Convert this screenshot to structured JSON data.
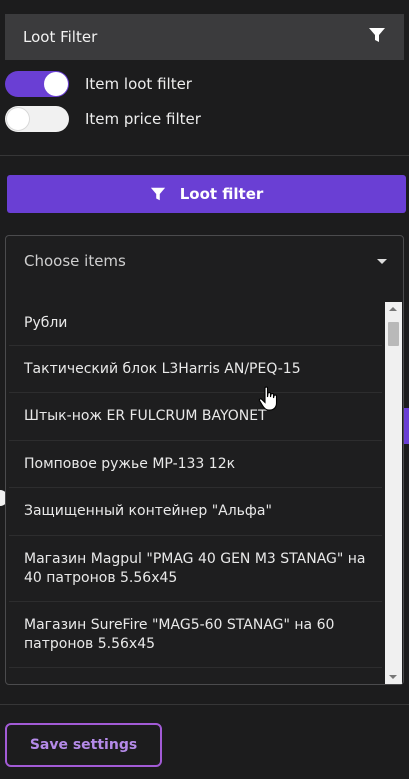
{
  "header": {
    "title": "Loot Filter",
    "icon": "filter-icon"
  },
  "toggles": [
    {
      "label": "Item loot filter",
      "state": "on"
    },
    {
      "label": "Item price filter",
      "state": "off"
    }
  ],
  "loot_button": {
    "label": "Loot filter",
    "icon": "filter-icon"
  },
  "select": {
    "placeholder": "Choose items",
    "options": [
      "Рубли",
      "Тактический блок L3Harris AN/PEQ-15",
      "Штык-нож ER FULCRUM BAYONET",
      "Помповое ружье MP-133 12к",
      "Защищенный контейнер \"Альфа\"",
      "Магазин Magpul \"PMAG 40 GEN M3 STANAG\" на 40 патронов 5.56x45",
      "Магазин SureFire \"MAG5-60 STANAG\" на 60 патронов 5.56x45"
    ]
  },
  "save_button": {
    "label": "Save settings"
  },
  "colors": {
    "accent": "#6a3fd4",
    "save_border": "#a25bd6",
    "background": "#1c1c1d"
  }
}
